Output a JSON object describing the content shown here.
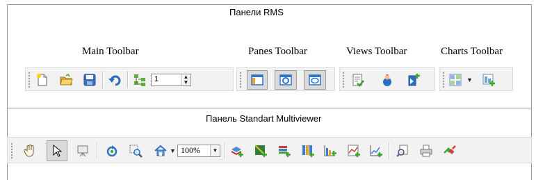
{
  "rms_panel": {
    "title": "Панели RMS",
    "toolbar_labels": {
      "main": "Main Toolbar",
      "panes": "Panes Toolbar",
      "views": "Views Toolbar",
      "charts": "Charts Toolbar"
    },
    "spinner_value": "1"
  },
  "multiviewer_panel": {
    "title": "Панель Standart Multiviewer",
    "zoom_value": "100%"
  }
}
